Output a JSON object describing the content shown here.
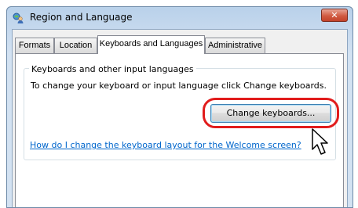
{
  "window": {
    "title": "Region and Language",
    "close_glyph": "✕",
    "icon": "globe-person-icon"
  },
  "tabs": [
    {
      "label": "Formats",
      "active": false
    },
    {
      "label": "Location",
      "active": false
    },
    {
      "label": "Keyboards and Languages",
      "active": true
    },
    {
      "label": "Administrative",
      "active": false
    }
  ],
  "panel": {
    "group_title": "Keyboards and other input languages",
    "description": "To change your keyboard or input language click Change keyboards.",
    "change_button_label": "Change keyboards...",
    "help_link": "How do I change the keyboard layout for the Welcome screen?"
  },
  "colors": {
    "highlight_ring": "#e11c1c",
    "link": "#0066cc",
    "close_button": "#d15b42"
  }
}
